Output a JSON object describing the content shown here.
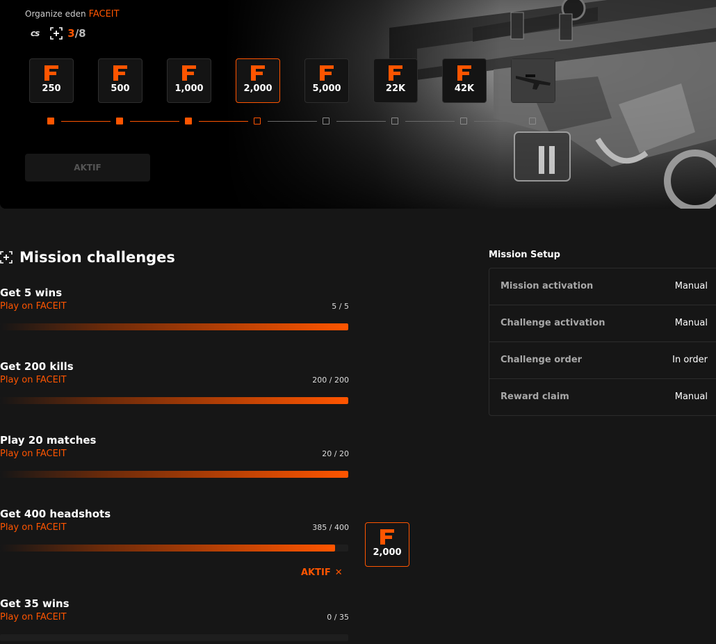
{
  "header": {
    "organizer_prefix": "Organize eden",
    "organizer_brand": "FACEIT",
    "game_logo_text": "cs",
    "progress_current": "3",
    "progress_total": "/8",
    "action_label": "AKTIF"
  },
  "rewards": [
    {
      "value": "250",
      "state": "done"
    },
    {
      "value": "500",
      "state": "done"
    },
    {
      "value": "1,000",
      "state": "done"
    },
    {
      "value": "2,000",
      "state": "current"
    },
    {
      "value": "5,000",
      "state": "todo"
    },
    {
      "value": "22K",
      "state": "todo"
    },
    {
      "value": "42K",
      "state": "todo"
    },
    {
      "value": "",
      "state": "todo",
      "kind": "weapon-skin-image"
    }
  ],
  "section": {
    "title": "Mission challenges"
  },
  "challenges": [
    {
      "name": "Get 5 wins",
      "sub": "Play on FACEIT",
      "progress": "5 / 5",
      "fraction": 1.0
    },
    {
      "name": "Get 200 kills",
      "sub": "Play on FACEIT",
      "progress": "200 / 200",
      "fraction": 1.0
    },
    {
      "name": "Play 20 matches",
      "sub": "Play on FACEIT",
      "progress": "20 / 20",
      "fraction": 1.0
    },
    {
      "name": "Get 400 headshots",
      "sub": "Play on FACEIT",
      "progress": "385 / 400",
      "fraction": 0.9625
    },
    {
      "name": "Get 35 wins",
      "sub": "Play on FACEIT",
      "progress": "0 / 35",
      "fraction": 0
    }
  ],
  "claim": {
    "value": "2,000",
    "action_label": "AKTIF",
    "close_glyph": "✕"
  },
  "setup": {
    "title": "Mission Setup",
    "rows": [
      {
        "label": "Mission activation",
        "value": "Manual"
      },
      {
        "label": "Challenge activation",
        "value": "Manual"
      },
      {
        "label": "Challenge order",
        "value": "In order"
      },
      {
        "label": "Reward claim",
        "value": "Manual"
      }
    ]
  },
  "colors": {
    "accent": "#ff5500",
    "background": "#161616"
  }
}
